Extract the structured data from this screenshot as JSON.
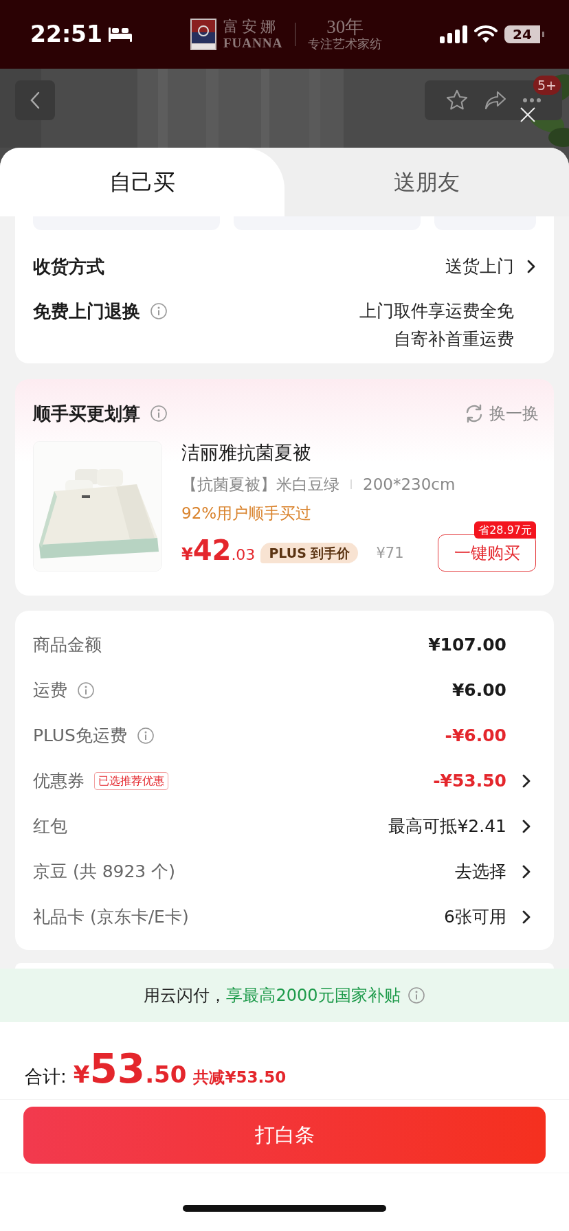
{
  "status_bar": {
    "time": "22:51",
    "battery": "24"
  },
  "banner": {
    "brand_cn": "富安娜",
    "brand_en": "FUANNA",
    "years": "30年",
    "slogan": "专注艺术家纺"
  },
  "nav": {
    "badge": "5+"
  },
  "tabs": [
    {
      "label": "自己买",
      "selected": true
    },
    {
      "label": "送朋友",
      "selected": false
    }
  ],
  "delivery": [
    {
      "label": "收货方式",
      "info": false,
      "value_lines": [
        "送货上门"
      ],
      "arrow": true
    },
    {
      "label": "免费上门退换",
      "info": true,
      "value_lines": [
        "上门取件享运费全免",
        "自寄补首重运费"
      ],
      "arrow": false
    }
  ],
  "recommend": {
    "title": "顺手买更划算",
    "refresh": "换一换",
    "product": {
      "kind": "picture",
      "name": "洁丽雅抗菌夏被",
      "spec": "【抗菌夏被】米白豆绿",
      "size": "200*230cm",
      "note": "92%用户顺手买过",
      "currency": "¥",
      "price_int": "42",
      "price_dec": ".03",
      "price_tag": "PLUS 到手价",
      "original": "¥71",
      "saving": "省28.97元",
      "buy": "一键购买"
    }
  },
  "summary": [
    {
      "label": "商品金额",
      "info": false,
      "value": "¥107.00",
      "kind": "strong",
      "arrow": false
    },
    {
      "label": "运费",
      "info": true,
      "value": "¥6.00",
      "kind": "strong",
      "arrow": false
    },
    {
      "label": "PLUS免运费",
      "info": true,
      "value": "-¥6.00",
      "kind": "red",
      "arrow": false
    },
    {
      "label": "优惠券",
      "info": false,
      "tag": "已选推荐优惠",
      "value": "-¥53.50",
      "kind": "red",
      "arrow": true
    },
    {
      "label": "红包",
      "info": false,
      "value": "最高可抵¥2.41",
      "kind": "plain",
      "arrow": true
    },
    {
      "label": "京豆 (共 8923 个)",
      "info": false,
      "value": "去选择",
      "kind": "plain",
      "arrow": true
    },
    {
      "label": "礼品卡 (京东卡/E卡)",
      "info": false,
      "value": "6张可用",
      "kind": "plain",
      "arrow": true
    }
  ],
  "promo": {
    "text": "用云闪付，",
    "highlight": "享最高2000元国家补贴"
  },
  "total": {
    "label": "合计:",
    "currency": "¥",
    "int": "53",
    "dec": ".50",
    "saved": "共减¥53.50"
  },
  "pay_button": "打白条"
}
